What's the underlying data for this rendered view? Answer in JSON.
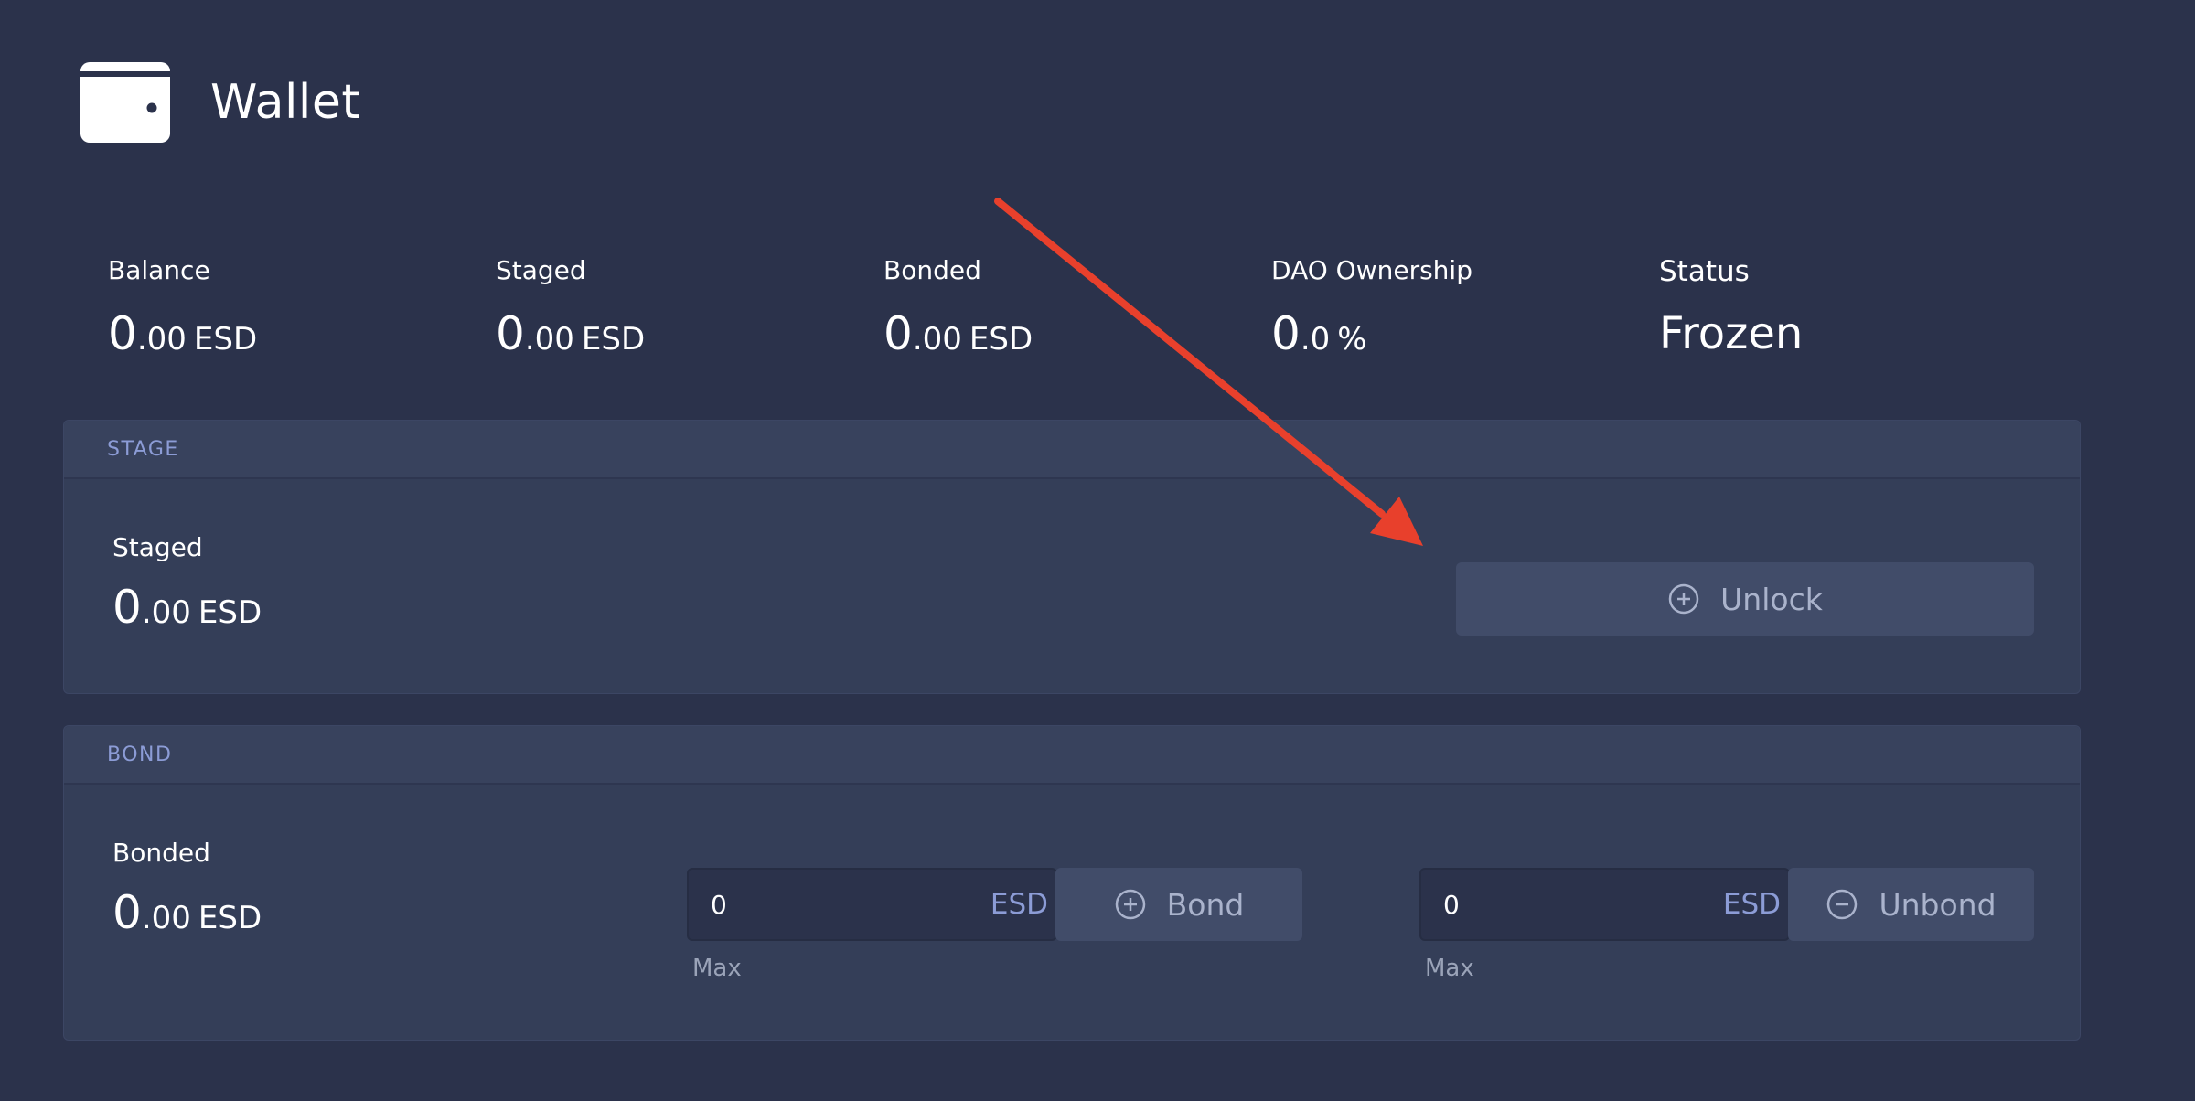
{
  "header": {
    "title": "Wallet",
    "icon": "wallet-icon"
  },
  "summary": {
    "balance": {
      "label": "Balance",
      "int": "0",
      "dec": ".00",
      "unit": "ESD"
    },
    "staged": {
      "label": "Staged",
      "int": "0",
      "dec": ".00",
      "unit": "ESD"
    },
    "bonded": {
      "label": "Bonded",
      "int": "0",
      "dec": ".00",
      "unit": "ESD"
    },
    "dao": {
      "label": "DAO Ownership",
      "int": "0",
      "dec": ".0",
      "unit": "%"
    },
    "status": {
      "label": "Status",
      "value": "Frozen"
    }
  },
  "stage_panel": {
    "title": "STAGE",
    "staged": {
      "label": "Staged",
      "int": "0",
      "dec": ".00",
      "unit": "ESD"
    },
    "unlock_label": "Unlock"
  },
  "bond_panel": {
    "title": "BOND",
    "bonded": {
      "label": "Bonded",
      "int": "0",
      "dec": ".00",
      "unit": "ESD"
    },
    "bond_input": {
      "value": "0",
      "unit": "ESD",
      "max_label": "Max"
    },
    "bond_label": "Bond",
    "unbond_input": {
      "value": "0",
      "unit": "ESD",
      "max_label": "Max"
    },
    "unbond_label": "Unbond"
  },
  "colors": {
    "background": "#2b324b",
    "panel": "#343e58",
    "accent": "#8c9cd6",
    "button": "#414c69",
    "annotation_arrow": "#e8402c"
  }
}
